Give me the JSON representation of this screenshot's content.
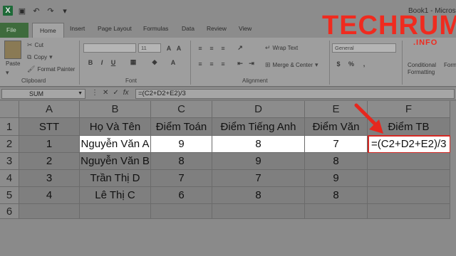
{
  "window": {
    "title": "Book1 - Micros"
  },
  "tabs": [
    "File",
    "Home",
    "Insert",
    "Page Layout",
    "Formulas",
    "Data",
    "Review",
    "View"
  ],
  "ribbon": {
    "clipboard": {
      "paste": "Paste",
      "cut": "Cut",
      "copy": "Copy",
      "format_painter": "Format Painter",
      "label": "Clipboard"
    },
    "font": {
      "size": "11",
      "label": "Font"
    },
    "alignment": {
      "wrap_text": "Wrap Text",
      "merge_center": "Merge & Center",
      "label": "Alignment"
    },
    "number": {
      "format": "General"
    },
    "styles": {
      "conditional_1": "Conditional",
      "conditional_2": "Formatting",
      "format_as": "Forma"
    }
  },
  "logo": {
    "main": "TECHRUM",
    "sub": ".INFO"
  },
  "formula_bar": {
    "name_box": "SUM",
    "cancel": "✕",
    "enter": "✓",
    "fx": "fx",
    "formula": "=(C2+D2+E2)/3"
  },
  "columns": [
    "A",
    "B",
    "C",
    "D",
    "E",
    "F"
  ],
  "rows": [
    "1",
    "2",
    "3",
    "4",
    "5",
    "6"
  ],
  "sheet": {
    "header": [
      "STT",
      "Họ Và Tên",
      "Điểm Toán",
      "Điểm Tiếng Anh",
      "Điểm Văn",
      "Điểm TB"
    ],
    "data": [
      [
        "1",
        "Nguyễn Văn A",
        "9",
        "8",
        "7",
        "=(C2+D2+E2)/3"
      ],
      [
        "2",
        "Nguyễn Văn B",
        "8",
        "9",
        "8",
        ""
      ],
      [
        "3",
        "Trần Thị D",
        "7",
        "7",
        "9",
        ""
      ],
      [
        "4",
        "Lê Thị C",
        "6",
        "8",
        "8",
        ""
      ]
    ]
  },
  "colors": {
    "selection_border": "#d42a25",
    "arrow": "#e6271e",
    "logo": "#ef2b1f"
  }
}
